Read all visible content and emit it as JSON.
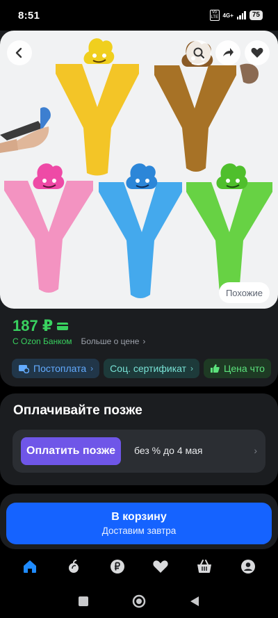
{
  "status": {
    "time": "8:51",
    "volte": "Vo LTE",
    "network": "4G+",
    "battery": "75"
  },
  "gallery": {
    "back_icon": "chevron-left-icon",
    "icons": [
      "lens-search-icon",
      "share-icon",
      "heart-icon"
    ],
    "similar_label": "Похожие"
  },
  "price": {
    "amount": "187 ₽",
    "bank_label": "С Ozon Банком",
    "more_label": "Больше о цене"
  },
  "chips": [
    {
      "label": "Постоплата",
      "icon": "card-clock-icon"
    },
    {
      "label": "Соц. сертификат",
      "icon": ""
    },
    {
      "label": "Цена что",
      "icon": "thumbs-up-icon"
    }
  ],
  "pay_later": {
    "title": "Оплачивайте позже",
    "button_label": "Оплатить позже",
    "note": "без % до 4 мая"
  },
  "cart": {
    "title": "В корзину",
    "subtitle": "Доставим завтра"
  },
  "nav": {
    "items": [
      "home-icon",
      "fresh-icon",
      "ruble-icon",
      "favorites-icon",
      "cart-icon",
      "profile-icon"
    ],
    "active": "home-icon",
    "active_color": "#1f8bff"
  },
  "colors": {
    "accent_green": "#39d15f",
    "accent_blue": "#1563ff",
    "pay_purple": "#6f56e8"
  }
}
